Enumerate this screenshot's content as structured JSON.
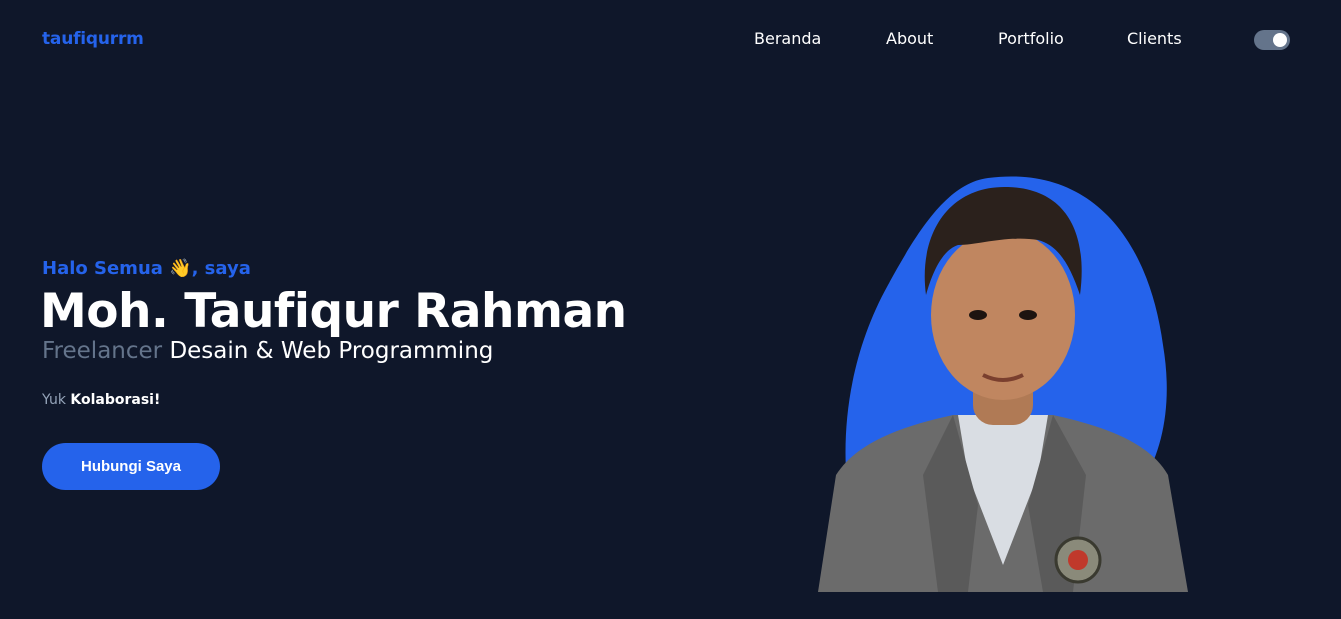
{
  "header": {
    "brand": "taufiqurrm",
    "nav": [
      "Beranda",
      "About",
      "Portfolio",
      "Clients"
    ],
    "theme_toggle": {
      "state": "on"
    }
  },
  "hero": {
    "greeting": "Halo Semua 👋, saya",
    "name": "Moh. Taufiqur Rahman",
    "role_muted": "Freelancer",
    "role_strong": "Desain & Web Programming",
    "collab_muted": "Yuk",
    "collab_strong": "Kolaborasi!",
    "cta_label": "Hubungi Saya"
  },
  "portrait": {
    "blob_color": "#2563eb",
    "subject": "profile-photo"
  },
  "colors": {
    "background": "#0f172a",
    "accent": "#2563eb",
    "muted_text": "#64748b"
  }
}
